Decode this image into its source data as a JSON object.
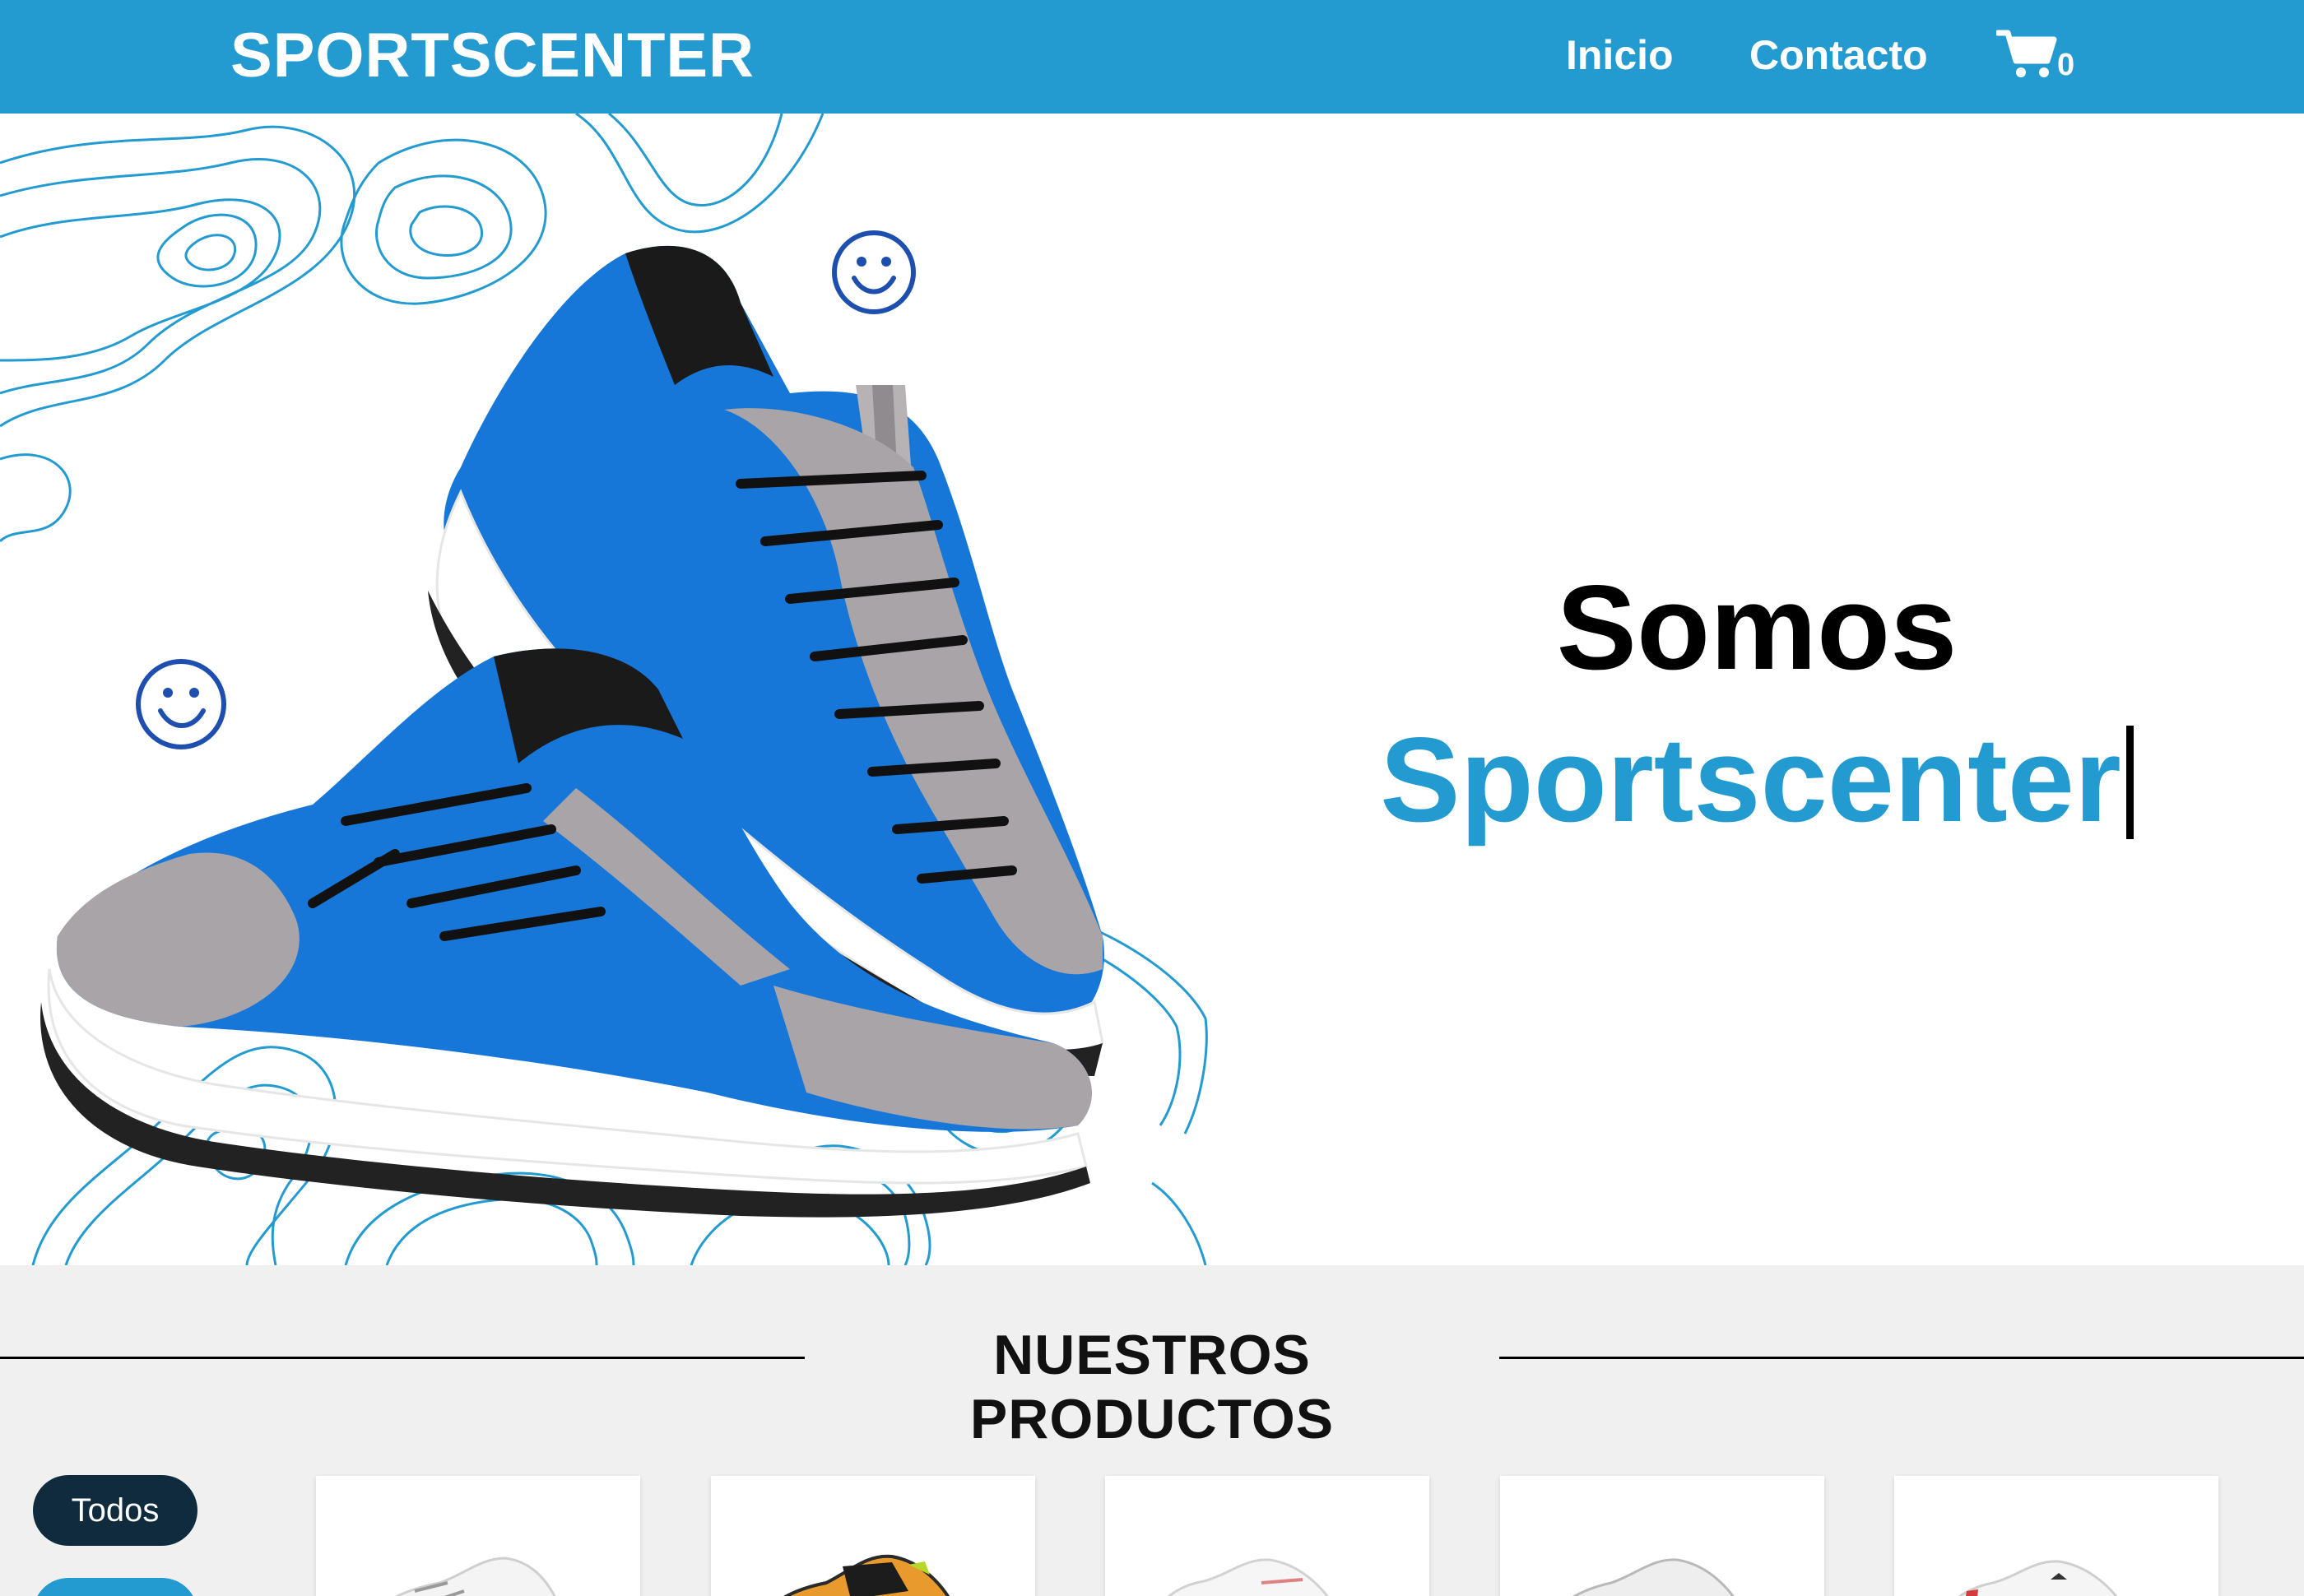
{
  "navbar": {
    "brand": "SPORTSCENTER",
    "links": [
      "Inicio",
      "Contacto"
    ],
    "cart_icon": "shopping-cart-icon",
    "cart_count": "0",
    "color": "#239bd0"
  },
  "hero": {
    "line1": "Somos",
    "line2": "Sportscenter",
    "accent_color": "#239bd0",
    "image": "blue-sneakers-illustration"
  },
  "products": {
    "section_title": "NUESTROS PRODUCTOS",
    "filters": [
      "Todos",
      ""
    ],
    "cards": [
      {
        "image": "white-sneaker-image"
      },
      {
        "image": "orange-black-sneaker-image"
      },
      {
        "image": "white-sneaker-image"
      },
      {
        "image": "white-grey-sneaker-image"
      },
      {
        "image": "white-red-sneaker-image"
      }
    ]
  }
}
